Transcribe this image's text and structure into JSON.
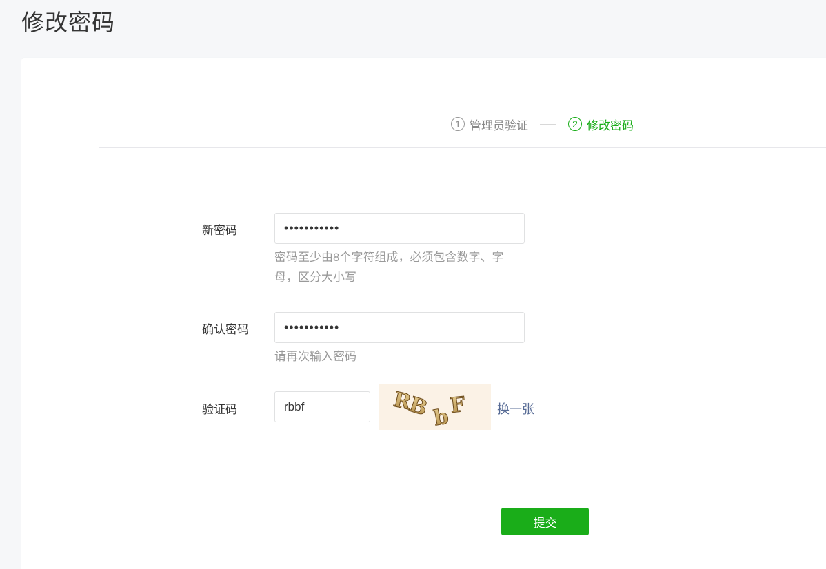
{
  "page": {
    "title": "修改密码"
  },
  "steps": [
    {
      "number": "1",
      "label": "管理员验证",
      "state": "done"
    },
    {
      "number": "2",
      "label": "修改密码",
      "state": "active"
    }
  ],
  "form": {
    "new_password": {
      "label": "新密码",
      "value": "•••••••••••",
      "hint": "密码至少由8个字符组成，必须包含数字、字母，区分大小写"
    },
    "confirm_password": {
      "label": "确认密码",
      "value": "•••••••••••",
      "hint": "请再次输入密码"
    },
    "captcha": {
      "label": "验证码",
      "value": "rbbf",
      "image_text": "RBbF",
      "refresh_label": "换一张"
    },
    "submit_label": "提交"
  },
  "colors": {
    "accent": "#1aad19",
    "link": "#576b95",
    "hint": "#9a9a9a"
  }
}
